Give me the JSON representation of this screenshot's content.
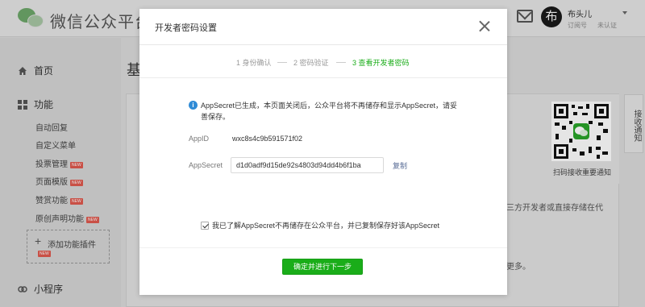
{
  "topbar": {
    "brand": "微信公众平台",
    "account_avatar_char": "布",
    "account_name": "布头儿",
    "account_type": "订阅号",
    "account_status": "未认证"
  },
  "sidebar": {
    "home": "首页",
    "features": "功能",
    "items": [
      {
        "label": "自动回复",
        "new": false
      },
      {
        "label": "自定义菜单",
        "new": false
      },
      {
        "label": "投票管理",
        "new": true
      },
      {
        "label": "页面模版",
        "new": true
      },
      {
        "label": "赞赏功能",
        "new": true
      },
      {
        "label": "原创声明功能",
        "new": true
      }
    ],
    "add_plugin": "添加功能插件",
    "new_tag": "NEW",
    "mini_program": "小程序"
  },
  "main": {
    "title_partial": "基",
    "bg_text_1": "三方开发者或直接存储在代",
    "bg_text_2": "更多。",
    "qr_caption": "扫码接收重要通知",
    "side_tab": "接收通知"
  },
  "dialog": {
    "title": "开发者密码设置",
    "steps": [
      "1 身份确认",
      "2 密码验证",
      "3 查看开发者密码"
    ],
    "info_text": "AppSecret已生成，本页面关闭后，公众平台将不再储存和显示AppSecret，请妥善保存。",
    "appid_label": "AppID",
    "appid_value": "wxc8s4c9b591571f02",
    "secret_label": "AppSecret",
    "secret_value": "d1d0adf9d15de92s4803d94dd4b6f1ba",
    "copy_label": "复制",
    "checkbox_label": "我已了解AppSecret不再储存在公众平台，并已复制保存好该AppSecret",
    "checkbox_checked": true,
    "next_button": "确定并进行下一步"
  },
  "colors": {
    "accent_green": "#1aad19",
    "info_blue": "#2f8bd6",
    "link": "#576b95",
    "new_tag": "#e05a4f"
  }
}
